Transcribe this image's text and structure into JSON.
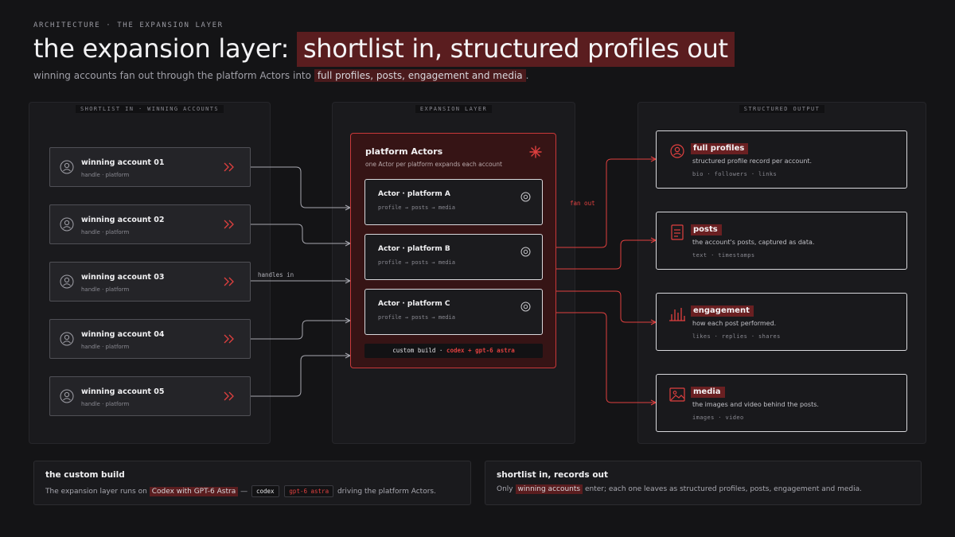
{
  "header": {
    "eyebrow": "ARCHITECTURE · THE EXPANSION LAYER",
    "title_plain": "the expansion layer:",
    "title_highlight": "shortlist in, structured profiles out",
    "subtitle_plain": "winning accounts fan out through the platform Actors into",
    "subtitle_highlight": "full profiles, posts, engagement and media",
    "subtitle_end": "."
  },
  "panels": {
    "left_label": "SHORTLIST IN · WINNING ACCOUNTS",
    "middle_label": "EXPANSION LAYER",
    "right_label": "STRUCTURED OUTPUT"
  },
  "accounts": [
    {
      "name": "winning account 01",
      "meta": "handle · platform"
    },
    {
      "name": "winning account 02",
      "meta": "handle · platform"
    },
    {
      "name": "winning account 03",
      "meta": "handle · platform"
    },
    {
      "name": "winning account 04",
      "meta": "handle · platform"
    },
    {
      "name": "winning account 05",
      "meta": "handle · platform"
    }
  ],
  "actors": {
    "title": "platform Actors",
    "subtitle": "one Actor per platform expands each account",
    "items": [
      {
        "name": "Actor · platform A",
        "meta": "profile → posts → media"
      },
      {
        "name": "Actor · platform B",
        "meta": "profile → posts → media"
      },
      {
        "name": "Actor · platform C",
        "meta": "profile → posts → media"
      }
    ],
    "custom_build_prefix": "custom build ·",
    "custom_build_accent": "codex + gpt-6 astra"
  },
  "connectors": {
    "handles_in": "handles in",
    "fan_out": "fan out"
  },
  "outputs": [
    {
      "name": "full profiles",
      "icon": "profile-icon",
      "desc": "structured profile record per account.",
      "tags": "bio · followers · links"
    },
    {
      "name": "posts",
      "icon": "document-icon",
      "desc": "the account's posts, captured as data.",
      "tags": "text · timestamps"
    },
    {
      "name": "engagement",
      "icon": "bar-chart-icon",
      "desc": "how each post performed.",
      "tags": "likes · replies · shares"
    },
    {
      "name": "media",
      "icon": "image-icon",
      "desc": "the images and video behind the posts.",
      "tags": "images · video"
    }
  ],
  "footer": {
    "left": {
      "title": "the custom build",
      "body_start": "The expansion layer runs on",
      "body_highlight": "Codex with GPT-6 Astra",
      "body_dash": "—",
      "chip1": "codex",
      "chip2": "gpt-6 astra",
      "body_end": "driving the platform Actors."
    },
    "right": {
      "title": "shortlist in, records out",
      "body_start": "Only",
      "body_highlight": "winning accounts",
      "body_end": "enter; each one leaves as structured profiles, posts, engagement and media."
    }
  },
  "colors": {
    "accent": "#e0403f",
    "highlight": "#5a1d1f",
    "background": "#141416"
  }
}
